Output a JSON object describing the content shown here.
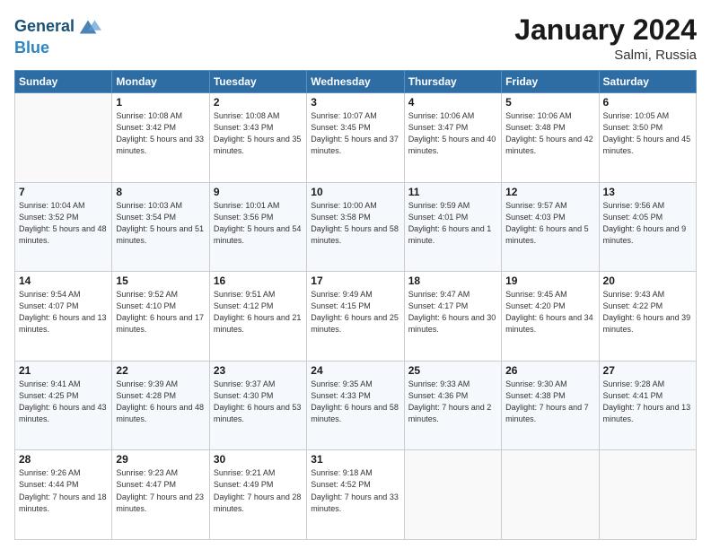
{
  "header": {
    "logo_line1": "General",
    "logo_line2": "Blue",
    "month_title": "January 2024",
    "location": "Salmi, Russia"
  },
  "days_of_week": [
    "Sunday",
    "Monday",
    "Tuesday",
    "Wednesday",
    "Thursday",
    "Friday",
    "Saturday"
  ],
  "weeks": [
    [
      {
        "day": "",
        "sunrise": "",
        "sunset": "",
        "daylight": ""
      },
      {
        "day": "1",
        "sunrise": "Sunrise: 10:08 AM",
        "sunset": "Sunset: 3:42 PM",
        "daylight": "Daylight: 5 hours and 33 minutes."
      },
      {
        "day": "2",
        "sunrise": "Sunrise: 10:08 AM",
        "sunset": "Sunset: 3:43 PM",
        "daylight": "Daylight: 5 hours and 35 minutes."
      },
      {
        "day": "3",
        "sunrise": "Sunrise: 10:07 AM",
        "sunset": "Sunset: 3:45 PM",
        "daylight": "Daylight: 5 hours and 37 minutes."
      },
      {
        "day": "4",
        "sunrise": "Sunrise: 10:06 AM",
        "sunset": "Sunset: 3:47 PM",
        "daylight": "Daylight: 5 hours and 40 minutes."
      },
      {
        "day": "5",
        "sunrise": "Sunrise: 10:06 AM",
        "sunset": "Sunset: 3:48 PM",
        "daylight": "Daylight: 5 hours and 42 minutes."
      },
      {
        "day": "6",
        "sunrise": "Sunrise: 10:05 AM",
        "sunset": "Sunset: 3:50 PM",
        "daylight": "Daylight: 5 hours and 45 minutes."
      }
    ],
    [
      {
        "day": "7",
        "sunrise": "Sunrise: 10:04 AM",
        "sunset": "Sunset: 3:52 PM",
        "daylight": "Daylight: 5 hours and 48 minutes."
      },
      {
        "day": "8",
        "sunrise": "Sunrise: 10:03 AM",
        "sunset": "Sunset: 3:54 PM",
        "daylight": "Daylight: 5 hours and 51 minutes."
      },
      {
        "day": "9",
        "sunrise": "Sunrise: 10:01 AM",
        "sunset": "Sunset: 3:56 PM",
        "daylight": "Daylight: 5 hours and 54 minutes."
      },
      {
        "day": "10",
        "sunrise": "Sunrise: 10:00 AM",
        "sunset": "Sunset: 3:58 PM",
        "daylight": "Daylight: 5 hours and 58 minutes."
      },
      {
        "day": "11",
        "sunrise": "Sunrise: 9:59 AM",
        "sunset": "Sunset: 4:01 PM",
        "daylight": "Daylight: 6 hours and 1 minute."
      },
      {
        "day": "12",
        "sunrise": "Sunrise: 9:57 AM",
        "sunset": "Sunset: 4:03 PM",
        "daylight": "Daylight: 6 hours and 5 minutes."
      },
      {
        "day": "13",
        "sunrise": "Sunrise: 9:56 AM",
        "sunset": "Sunset: 4:05 PM",
        "daylight": "Daylight: 6 hours and 9 minutes."
      }
    ],
    [
      {
        "day": "14",
        "sunrise": "Sunrise: 9:54 AM",
        "sunset": "Sunset: 4:07 PM",
        "daylight": "Daylight: 6 hours and 13 minutes."
      },
      {
        "day": "15",
        "sunrise": "Sunrise: 9:52 AM",
        "sunset": "Sunset: 4:10 PM",
        "daylight": "Daylight: 6 hours and 17 minutes."
      },
      {
        "day": "16",
        "sunrise": "Sunrise: 9:51 AM",
        "sunset": "Sunset: 4:12 PM",
        "daylight": "Daylight: 6 hours and 21 minutes."
      },
      {
        "day": "17",
        "sunrise": "Sunrise: 9:49 AM",
        "sunset": "Sunset: 4:15 PM",
        "daylight": "Daylight: 6 hours and 25 minutes."
      },
      {
        "day": "18",
        "sunrise": "Sunrise: 9:47 AM",
        "sunset": "Sunset: 4:17 PM",
        "daylight": "Daylight: 6 hours and 30 minutes."
      },
      {
        "day": "19",
        "sunrise": "Sunrise: 9:45 AM",
        "sunset": "Sunset: 4:20 PM",
        "daylight": "Daylight: 6 hours and 34 minutes."
      },
      {
        "day": "20",
        "sunrise": "Sunrise: 9:43 AM",
        "sunset": "Sunset: 4:22 PM",
        "daylight": "Daylight: 6 hours and 39 minutes."
      }
    ],
    [
      {
        "day": "21",
        "sunrise": "Sunrise: 9:41 AM",
        "sunset": "Sunset: 4:25 PM",
        "daylight": "Daylight: 6 hours and 43 minutes."
      },
      {
        "day": "22",
        "sunrise": "Sunrise: 9:39 AM",
        "sunset": "Sunset: 4:28 PM",
        "daylight": "Daylight: 6 hours and 48 minutes."
      },
      {
        "day": "23",
        "sunrise": "Sunrise: 9:37 AM",
        "sunset": "Sunset: 4:30 PM",
        "daylight": "Daylight: 6 hours and 53 minutes."
      },
      {
        "day": "24",
        "sunrise": "Sunrise: 9:35 AM",
        "sunset": "Sunset: 4:33 PM",
        "daylight": "Daylight: 6 hours and 58 minutes."
      },
      {
        "day": "25",
        "sunrise": "Sunrise: 9:33 AM",
        "sunset": "Sunset: 4:36 PM",
        "daylight": "Daylight: 7 hours and 2 minutes."
      },
      {
        "day": "26",
        "sunrise": "Sunrise: 9:30 AM",
        "sunset": "Sunset: 4:38 PM",
        "daylight": "Daylight: 7 hours and 7 minutes."
      },
      {
        "day": "27",
        "sunrise": "Sunrise: 9:28 AM",
        "sunset": "Sunset: 4:41 PM",
        "daylight": "Daylight: 7 hours and 13 minutes."
      }
    ],
    [
      {
        "day": "28",
        "sunrise": "Sunrise: 9:26 AM",
        "sunset": "Sunset: 4:44 PM",
        "daylight": "Daylight: 7 hours and 18 minutes."
      },
      {
        "day": "29",
        "sunrise": "Sunrise: 9:23 AM",
        "sunset": "Sunset: 4:47 PM",
        "daylight": "Daylight: 7 hours and 23 minutes."
      },
      {
        "day": "30",
        "sunrise": "Sunrise: 9:21 AM",
        "sunset": "Sunset: 4:49 PM",
        "daylight": "Daylight: 7 hours and 28 minutes."
      },
      {
        "day": "31",
        "sunrise": "Sunrise: 9:18 AM",
        "sunset": "Sunset: 4:52 PM",
        "daylight": "Daylight: 7 hours and 33 minutes."
      },
      {
        "day": "",
        "sunrise": "",
        "sunset": "",
        "daylight": ""
      },
      {
        "day": "",
        "sunrise": "",
        "sunset": "",
        "daylight": ""
      },
      {
        "day": "",
        "sunrise": "",
        "sunset": "",
        "daylight": ""
      }
    ]
  ]
}
